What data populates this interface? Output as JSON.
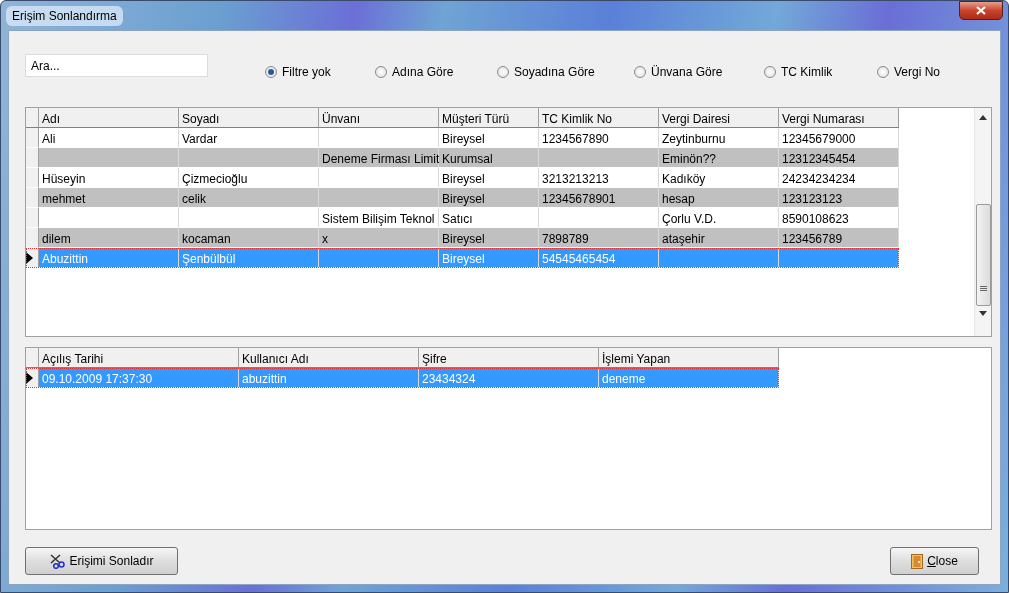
{
  "window": {
    "title": "Erişim Sonlandırma"
  },
  "search": {
    "placeholder": "Ara..."
  },
  "filters": [
    {
      "label": "Filtre yok",
      "selected": true
    },
    {
      "label": "Adına Göre",
      "selected": false
    },
    {
      "label": "Soyadına Göre",
      "selected": false
    },
    {
      "label": "Ünvana Göre",
      "selected": false
    },
    {
      "label": "TC Kimlik",
      "selected": false
    },
    {
      "label": "Vergi No",
      "selected": false
    }
  ],
  "customers_table": {
    "columns": [
      "Adı",
      "Soyadı",
      "Ünvanı",
      "Müşteri Türü",
      "TC Kimlik No",
      "Vergi Dairesi",
      "Vergi Numarası"
    ],
    "rows": [
      {
        "selected": false,
        "cells": [
          "Ali",
          "Vardar",
          "",
          "Bireysel",
          "1234567890",
          "Zeytinburnu",
          "12345679000"
        ]
      },
      {
        "selected": false,
        "cells": [
          "",
          "",
          "Deneme Firması Limit",
          "Kurumsal",
          "",
          "Eminön??",
          "12312345454"
        ]
      },
      {
        "selected": false,
        "cells": [
          "Hüseyin",
          "Çizmecioğlu",
          "",
          "Bireysel",
          "3213213213",
          "Kadıköy",
          "24234234234"
        ]
      },
      {
        "selected": false,
        "cells": [
          "mehmet",
          "celik",
          "",
          "Bireysel",
          "12345678901",
          "hesap",
          "123123123"
        ]
      },
      {
        "selected": false,
        "cells": [
          "",
          "",
          "Sistem Bilişim Teknol",
          "Satıcı",
          "",
          "Çorlu V.D.",
          "8590108623"
        ]
      },
      {
        "selected": false,
        "cells": [
          "dilem",
          "kocaman",
          "x",
          "Bireysel",
          "7898789",
          "ataşehir",
          "123456789"
        ]
      },
      {
        "selected": true,
        "cells": [
          "Abuzittin",
          "Şenbülbül",
          "",
          "Bireysel",
          "54545465454",
          "",
          ""
        ]
      }
    ]
  },
  "access_table": {
    "columns": [
      "Açılış Tarihi",
      "Kullanıcı Adı",
      "Şifre",
      "İşlemi Yapan"
    ],
    "rows": [
      {
        "selected": true,
        "cells": [
          "09.10.2009 17:37:30",
          "abuzittin",
          "23434324",
          "deneme"
        ]
      }
    ]
  },
  "buttons": [
    {
      "kind": "end",
      "label": "Erişimi Sonladır",
      "underline_first": false
    },
    {
      "kind": "close",
      "label": "Close",
      "underline_first": true
    }
  ]
}
